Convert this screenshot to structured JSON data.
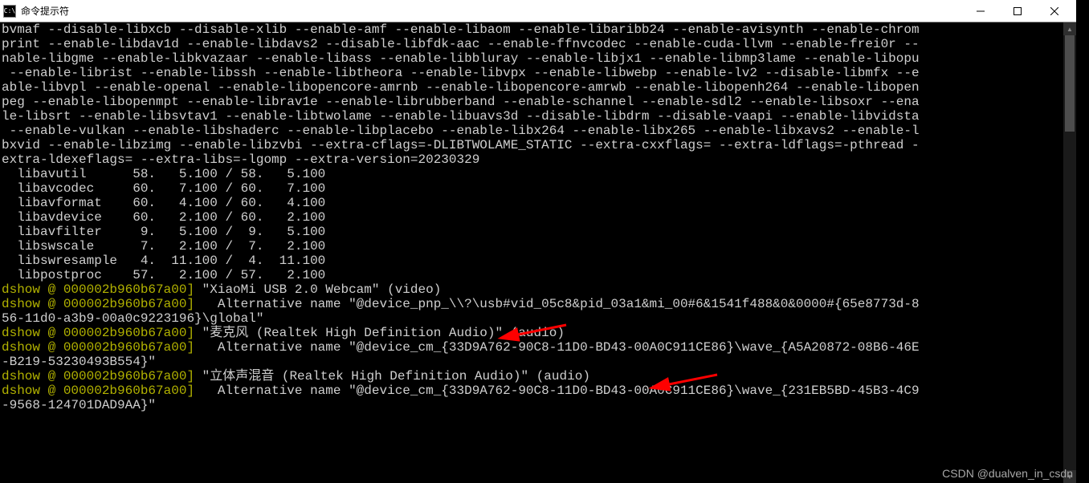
{
  "titlebar": {
    "text": "命令提示符",
    "icon_label": "C:\\"
  },
  "console": {
    "build_flags": "bvmaf --disable-libxcb --disable-xlib --enable-amf --enable-libaom --enable-libaribb24 --enable-avisynth --enable-chrom\nprint --enable-libdav1d --enable-libdavs2 --disable-libfdk-aac --enable-ffnvcodec --enable-cuda-llvm --enable-frei0r --\nnable-libgme --enable-libkvazaar --enable-libass --enable-libbluray --enable-libjx1 --enable-libmp3lame --enable-libopu\n --enable-librist --enable-libssh --enable-libtheora --enable-libvpx --enable-libwebp --enable-lv2 --disable-libmfx --e\nable-libvpl --enable-openal --enable-libopencore-amrnb --enable-libopencore-amrwb --enable-libopenh264 --enable-libopen\npeg --enable-libopenmpt --enable-librav1e --enable-librubberband --enable-schannel --enable-sdl2 --enable-libsoxr --ena\nle-libsrt --enable-libsvtav1 --enable-libtwolame --enable-libuavs3d --disable-libdrm --disable-vaapi --enable-libvidsta\n --enable-vulkan --enable-libshaderc --enable-libplacebo --enable-libx264 --enable-libx265 --enable-libxavs2 --enable-l\nbxvid --enable-libzimg --enable-libzvbi --extra-cflags=-DLIBTWOLAME_STATIC --extra-cxxflags= --extra-ldflags=-pthread -\nextra-ldexeflags= --extra-libs=-lgomp --extra-version=20230329",
    "libs": [
      {
        "name": "libavutil",
        "ver": "58.   5.100 / 58.   5.100"
      },
      {
        "name": "libavcodec",
        "ver": "60.   7.100 / 60.   7.100"
      },
      {
        "name": "libavformat",
        "ver": "60.   4.100 / 60.   4.100"
      },
      {
        "name": "libavdevice",
        "ver": "60.   2.100 / 60.   2.100"
      },
      {
        "name": "libavfilter",
        "ver": " 9.   5.100 /  9.   5.100"
      },
      {
        "name": "libswscale",
        "ver": " 7.   2.100 /  7.   2.100"
      },
      {
        "name": "libswresample",
        "ver": " 4.  11.100 /  4.  11.100"
      },
      {
        "name": "libpostproc",
        "ver": "57.   2.100 / 57.   2.100"
      }
    ],
    "dshow_prefix": "dshow @ 000002b960b67a00]",
    "lines_devices": [
      {
        "prefix": true,
        "text": " \"XiaoMi USB 2.0 Webcam\" (video)"
      },
      {
        "prefix": true,
        "text": "   Alternative name \"@device_pnp_\\\\?\\usb#vid_05c8&pid_03a1&mi_00#6&1541f488&0&0000#{65e8773d-8"
      },
      {
        "prefix": false,
        "text": "56-11d0-a3b9-00a0c9223196}\\global\""
      },
      {
        "prefix": true,
        "text": " \"麦克风 (Realtek High Definition Audio)\" (audio)"
      },
      {
        "prefix": true,
        "text": "   Alternative name \"@device_cm_{33D9A762-90C8-11D0-BD43-00A0C911CE86}\\wave_{A5A20872-08B6-46E"
      },
      {
        "prefix": false,
        "text": "-B219-53230493B554}\""
      },
      {
        "prefix": true,
        "text": " \"立体声混音 (Realtek High Definition Audio)\" (audio)"
      },
      {
        "prefix": true,
        "text": "   Alternative name \"@device_cm_{33D9A762-90C8-11D0-BD43-00A0C911CE86}\\wave_{231EB5BD-45B3-4C9"
      },
      {
        "prefix": false,
        "text": "-9568-124701DAD9AA}\""
      }
    ]
  },
  "watermark": "CSDN @dualven_in_csdn"
}
